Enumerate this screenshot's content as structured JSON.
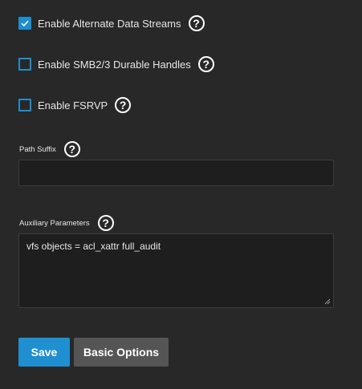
{
  "options": {
    "alternate_streams": {
      "label": "Enable Alternate Data Streams",
      "checked": true
    },
    "durable_handles": {
      "label": "Enable SMB2/3 Durable Handles",
      "checked": false
    },
    "fsrvp": {
      "label": "Enable FSRVP",
      "checked": false
    }
  },
  "path_suffix": {
    "label": "Path Suffix",
    "value": ""
  },
  "auxiliary": {
    "label": "Auxiliary Parameters",
    "value": "vfs objects = acl_xattr full_audit"
  },
  "help_glyph": "?",
  "buttons": {
    "save": "Save",
    "basic": "Basic Options"
  },
  "colors": {
    "accent": "#1f8fd1",
    "background": "#282828",
    "input_bg": "#1e1e1e",
    "secondary_button": "#555555"
  }
}
